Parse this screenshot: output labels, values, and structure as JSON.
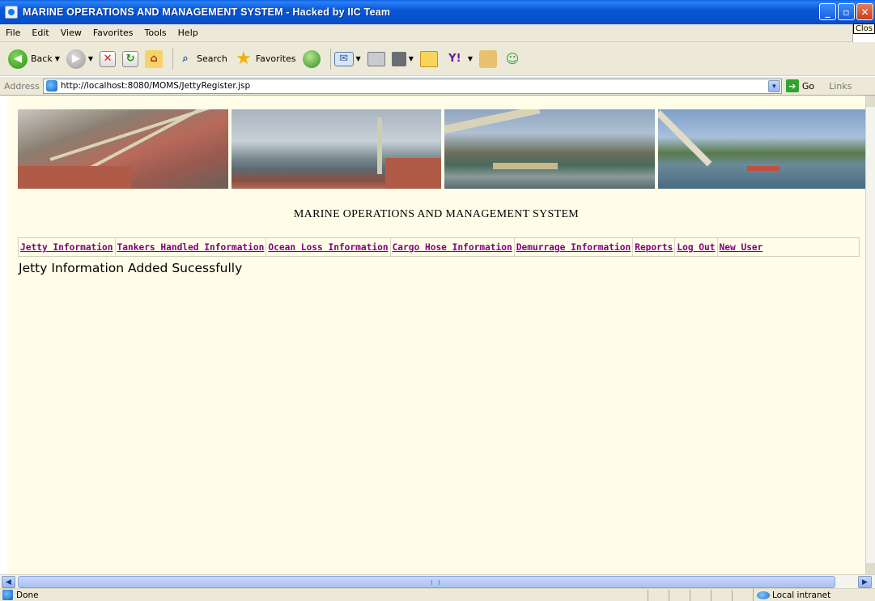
{
  "window": {
    "title": "MARINE OPERATIONS AND MANAGEMENT SYSTEM - Hacked by IIC Team",
    "tooltip": "Clos",
    "controls": [
      "_",
      "▫",
      "✕"
    ]
  },
  "menubar": {
    "items": [
      "File",
      "Edit",
      "View",
      "Favorites",
      "Tools",
      "Help"
    ]
  },
  "toolbar": {
    "back_label": "Back",
    "search_label": "Search",
    "favorites_label": "Favorites",
    "icons": [
      "back-icon",
      "forward-icon",
      "stop-icon",
      "refresh-icon",
      "home-icon",
      "search-icon",
      "favorites-icon",
      "media-icon",
      "mail-icon",
      "print-icon",
      "edit-icon",
      "notes-icon",
      "yahoo-icon",
      "research-icon",
      "messenger-icon"
    ]
  },
  "addressbar": {
    "label": "Address",
    "url": "http://localhost:8080/MOMS/JettyRegister.jsp",
    "go_label": "Go",
    "links_label": "Links"
  },
  "page": {
    "system_title": "MARINE OPERATIONS AND MANAGEMENT SYSTEM",
    "nav": [
      "Jetty Information",
      "Tankers Handled Information",
      "Ocean Loss Information",
      "Cargo Hose Information",
      "Demurrage Information",
      "Reports",
      "Log Out",
      "New User"
    ],
    "message": "Jetty Information Added Sucessfully",
    "link_color": "#800080",
    "background_color": "#fffde8"
  },
  "statusbar": {
    "status": "Done",
    "zone": "Local intranet"
  }
}
